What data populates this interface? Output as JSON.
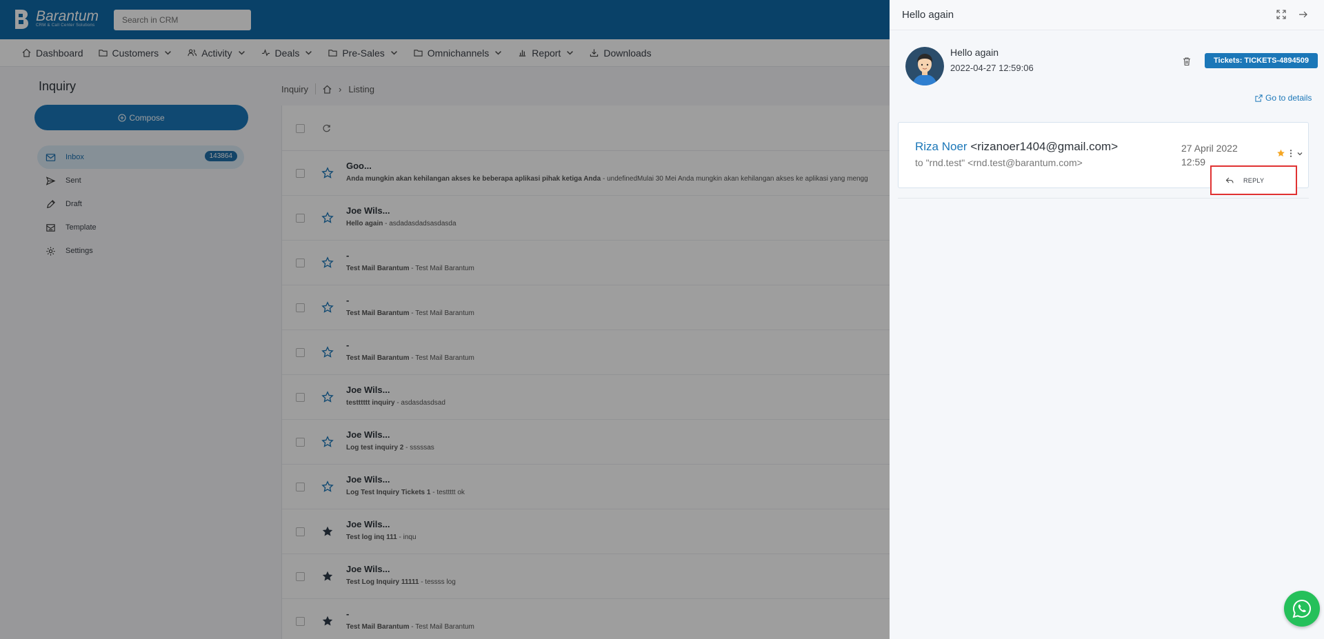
{
  "app": {
    "brand": "Barantum",
    "brand_sub": "CRM & Call Center Solutions",
    "search_placeholder": "Search in CRM"
  },
  "nav": [
    {
      "label": "Dashboard",
      "icon": "home-icon"
    },
    {
      "label": "Customers",
      "icon": "folder-icon"
    },
    {
      "label": "Activity",
      "icon": "users-icon"
    },
    {
      "label": "Deals",
      "icon": "pulse-icon"
    },
    {
      "label": "Pre-Sales",
      "icon": "folder-icon"
    },
    {
      "label": "Omnichannels",
      "icon": "folder-icon"
    },
    {
      "label": "Report",
      "icon": "bar-chart-icon"
    },
    {
      "label": "Downloads",
      "icon": "download-icon"
    }
  ],
  "sidebar": {
    "title": "Inquiry",
    "compose": "Compose",
    "folders": [
      {
        "label": "Inbox",
        "count": "143864",
        "icon": "mail-icon"
      },
      {
        "label": "Sent",
        "icon": "send-icon"
      },
      {
        "label": "Draft",
        "icon": "pencil-icon"
      },
      {
        "label": "Template",
        "icon": "template-icon"
      },
      {
        "label": "Settings",
        "icon": "gear-icon"
      }
    ]
  },
  "breadcrumb": {
    "module": "Inquiry",
    "page": "Listing"
  },
  "list": [
    {
      "sender": "Goo...",
      "subject": "Anda mungkin akan kehilangan akses ke beberapa aplikasi pihak ketiga Anda",
      "preview": " - undefinedMulai 30 Mei Anda mungkin akan kehilangan akses ke aplikasi yang mengg",
      "starred": false
    },
    {
      "sender": "Joe Wils...",
      "subject": "Hello again",
      "preview": " - asdadasdadsasdasda",
      "starred": false
    },
    {
      "sender": "-",
      "subject": "Test Mail Barantum",
      "preview": " - Test Mail Barantum",
      "starred": false
    },
    {
      "sender": "-",
      "subject": "Test Mail Barantum",
      "preview": " - Test Mail Barantum",
      "starred": false
    },
    {
      "sender": "-",
      "subject": "Test Mail Barantum",
      "preview": " - Test Mail Barantum",
      "starred": false
    },
    {
      "sender": "Joe Wils...",
      "subject": "testttttt inquiry",
      "preview": " - asdasdasdsad",
      "starred": false
    },
    {
      "sender": "Joe Wils...",
      "subject": "Log test inquiry 2",
      "preview": " - sssssas",
      "starred": false
    },
    {
      "sender": "Joe Wils...",
      "subject": "Log Test Inquiry Tickets 1",
      "preview": " - testtttt ok",
      "starred": false
    },
    {
      "sender": "Joe Wils...",
      "subject": "Test log inq 111",
      "preview": " - inqu",
      "starred": true
    },
    {
      "sender": "Joe Wils...",
      "subject": "Test Log Inquiry 11111",
      "preview": " - tessss log",
      "starred": true
    },
    {
      "sender": "-",
      "subject": "Test Mail Barantum",
      "preview": " - Test Mail Barantum",
      "starred": true
    }
  ],
  "panel": {
    "title": "Hello again",
    "subject": "Hello again",
    "datetime": "2022-04-27 12:59:06",
    "ticket": "Tickets: TICKETS-4894509",
    "goto": "Go to details",
    "from_name": "Riza Noer",
    "from_email": " <rizanoer1404@gmail.com>",
    "to": "to \"rnd.test\" <rnd.test@barantum.com>",
    "date": "27 April 2022",
    "time": "12:59",
    "menu_reply": "REPLY"
  },
  "colors": {
    "brand": "#0f6aa8",
    "accent": "#1b77b8",
    "highlight": "#e03131",
    "star": "#f5a623",
    "whatsapp": "#25c05a"
  }
}
